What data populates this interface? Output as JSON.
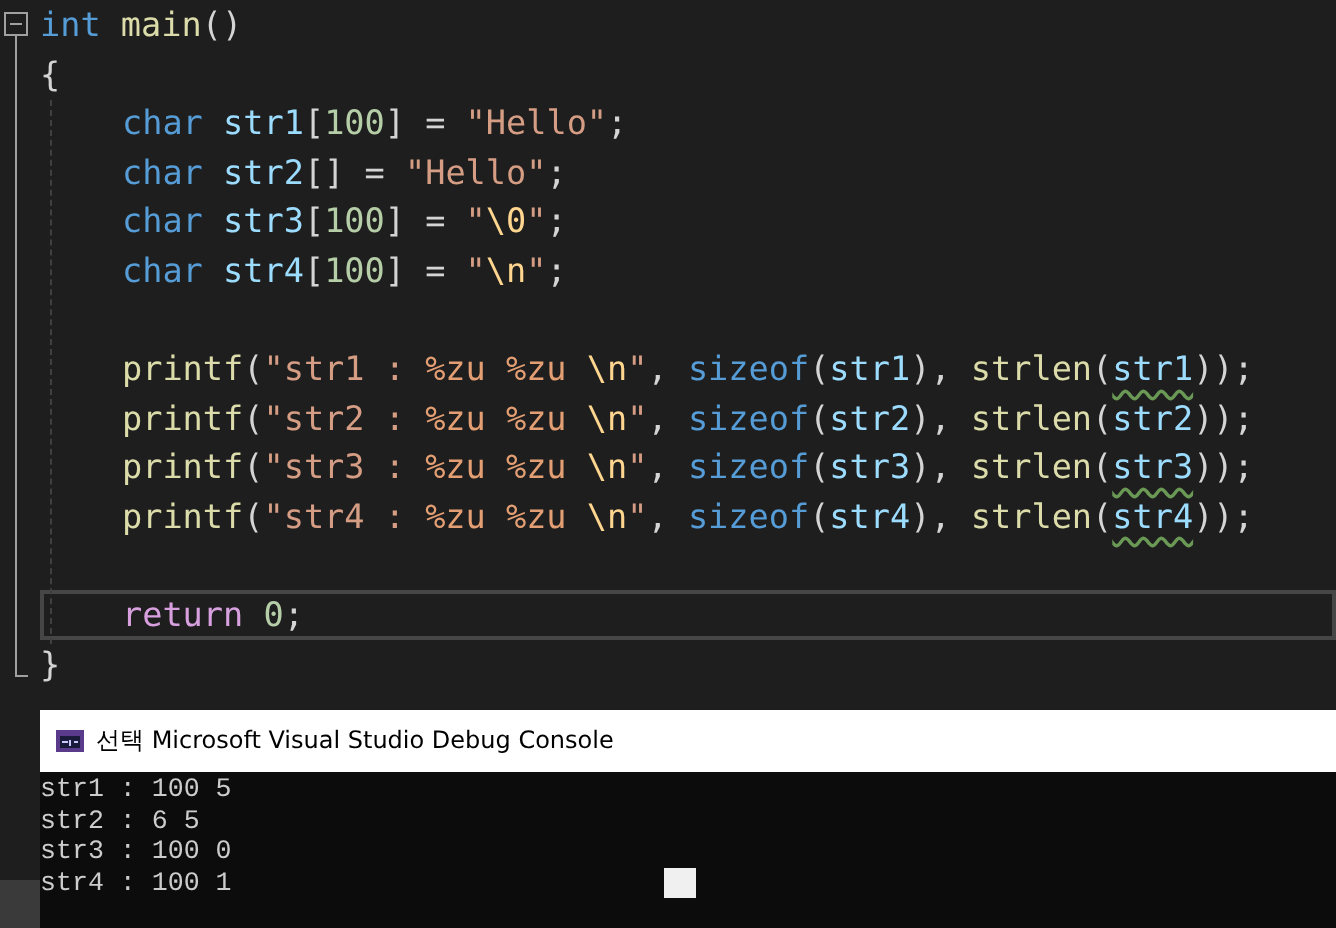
{
  "editor": {
    "lines": [
      {
        "current": false,
        "indented": false,
        "tokens": [
          {
            "text": "int",
            "kind": "keyword"
          },
          {
            "text": " main",
            "kind": "func"
          },
          {
            "text": "()",
            "kind": "punct"
          }
        ]
      },
      {
        "current": false,
        "indented": false,
        "tokens": [
          {
            "text": "{",
            "kind": "punct"
          }
        ]
      },
      {
        "current": false,
        "indented": true,
        "tokens": [
          {
            "text": "char",
            "kind": "keyword"
          },
          {
            "text": " str1",
            "kind": "var"
          },
          {
            "text": "[",
            "kind": "punct"
          },
          {
            "text": "100",
            "kind": "number"
          },
          {
            "text": "] = ",
            "kind": "punct"
          },
          {
            "text": "\"Hello\"",
            "kind": "string"
          },
          {
            "text": ";",
            "kind": "punct"
          }
        ]
      },
      {
        "current": false,
        "indented": true,
        "tokens": [
          {
            "text": "char",
            "kind": "keyword"
          },
          {
            "text": " str2",
            "kind": "var"
          },
          {
            "text": "[] = ",
            "kind": "punct"
          },
          {
            "text": "\"Hello\"",
            "kind": "string"
          },
          {
            "text": ";",
            "kind": "punct"
          }
        ]
      },
      {
        "current": false,
        "indented": true,
        "tokens": [
          {
            "text": "char",
            "kind": "keyword"
          },
          {
            "text": " str3",
            "kind": "var"
          },
          {
            "text": "[",
            "kind": "punct"
          },
          {
            "text": "100",
            "kind": "number"
          },
          {
            "text": "] = ",
            "kind": "punct"
          },
          {
            "text": "\"",
            "kind": "string"
          },
          {
            "text": "\\0",
            "kind": "escape"
          },
          {
            "text": "\"",
            "kind": "string"
          },
          {
            "text": ";",
            "kind": "punct"
          }
        ]
      },
      {
        "current": false,
        "indented": true,
        "blank_after": true,
        "tokens": [
          {
            "text": "char",
            "kind": "keyword"
          },
          {
            "text": " str4",
            "kind": "var"
          },
          {
            "text": "[",
            "kind": "punct"
          },
          {
            "text": "100",
            "kind": "number"
          },
          {
            "text": "] = ",
            "kind": "punct"
          },
          {
            "text": "\"",
            "kind": "string"
          },
          {
            "text": "\\n",
            "kind": "escape"
          },
          {
            "text": "\"",
            "kind": "string"
          },
          {
            "text": ";",
            "kind": "punct"
          }
        ]
      },
      {
        "current": false,
        "indented": true,
        "tokens": [
          {
            "text": "printf",
            "kind": "func"
          },
          {
            "text": "(",
            "kind": "punct"
          },
          {
            "text": "\"str1 : ",
            "kind": "string"
          },
          {
            "text": "%zu",
            "kind": "format"
          },
          {
            "text": " %zu",
            "kind": "format"
          },
          {
            "text": " \\n",
            "kind": "escape"
          },
          {
            "text": "\"",
            "kind": "string"
          },
          {
            "text": ", ",
            "kind": "punct"
          },
          {
            "text": "sizeof",
            "kind": "keyword"
          },
          {
            "text": "(",
            "kind": "punct"
          },
          {
            "text": "str1",
            "kind": "var"
          },
          {
            "text": "), ",
            "kind": "punct"
          },
          {
            "text": "strlen",
            "kind": "func"
          },
          {
            "text": "(",
            "kind": "punct"
          },
          {
            "text": "str1",
            "kind": "flagged-var"
          },
          {
            "text": "));",
            "kind": "punct"
          }
        ]
      },
      {
        "current": false,
        "indented": true,
        "tokens": [
          {
            "text": "printf",
            "kind": "func"
          },
          {
            "text": "(",
            "kind": "punct"
          },
          {
            "text": "\"str2 : ",
            "kind": "string"
          },
          {
            "text": "%zu",
            "kind": "format"
          },
          {
            "text": " %zu",
            "kind": "format"
          },
          {
            "text": " \\n",
            "kind": "escape"
          },
          {
            "text": "\"",
            "kind": "string"
          },
          {
            "text": ", ",
            "kind": "punct"
          },
          {
            "text": "sizeof",
            "kind": "keyword"
          },
          {
            "text": "(",
            "kind": "punct"
          },
          {
            "text": "str2",
            "kind": "var"
          },
          {
            "text": "), ",
            "kind": "punct"
          },
          {
            "text": "strlen",
            "kind": "func"
          },
          {
            "text": "(",
            "kind": "punct"
          },
          {
            "text": "str2",
            "kind": "var"
          },
          {
            "text": "));",
            "kind": "punct"
          }
        ]
      },
      {
        "current": false,
        "indented": true,
        "tokens": [
          {
            "text": "printf",
            "kind": "func"
          },
          {
            "text": "(",
            "kind": "punct"
          },
          {
            "text": "\"str3 : ",
            "kind": "string"
          },
          {
            "text": "%zu",
            "kind": "format"
          },
          {
            "text": " %zu",
            "kind": "format"
          },
          {
            "text": " \\n",
            "kind": "escape"
          },
          {
            "text": "\"",
            "kind": "string"
          },
          {
            "text": ", ",
            "kind": "punct"
          },
          {
            "text": "sizeof",
            "kind": "keyword"
          },
          {
            "text": "(",
            "kind": "punct"
          },
          {
            "text": "str3",
            "kind": "var"
          },
          {
            "text": "), ",
            "kind": "punct"
          },
          {
            "text": "strlen",
            "kind": "func"
          },
          {
            "text": "(",
            "kind": "punct"
          },
          {
            "text": "str3",
            "kind": "flagged-var"
          },
          {
            "text": "));",
            "kind": "punct"
          }
        ]
      },
      {
        "current": false,
        "indented": true,
        "blank_after": true,
        "tokens": [
          {
            "text": "printf",
            "kind": "func"
          },
          {
            "text": "(",
            "kind": "punct"
          },
          {
            "text": "\"str4 : ",
            "kind": "string"
          },
          {
            "text": "%zu",
            "kind": "format"
          },
          {
            "text": " %zu",
            "kind": "format"
          },
          {
            "text": " \\n",
            "kind": "escape"
          },
          {
            "text": "\"",
            "kind": "string"
          },
          {
            "text": ", ",
            "kind": "punct"
          },
          {
            "text": "sizeof",
            "kind": "keyword"
          },
          {
            "text": "(",
            "kind": "punct"
          },
          {
            "text": "str4",
            "kind": "var"
          },
          {
            "text": "), ",
            "kind": "punct"
          },
          {
            "text": "strlen",
            "kind": "func"
          },
          {
            "text": "(",
            "kind": "punct"
          },
          {
            "text": "str4",
            "kind": "flagged-var"
          },
          {
            "text": "));",
            "kind": "punct"
          }
        ]
      },
      {
        "current": true,
        "indented": true,
        "tokens": [
          {
            "text": "return",
            "kind": "control"
          },
          {
            "text": " 0",
            "kind": "number"
          },
          {
            "text": ";",
            "kind": "punct"
          }
        ]
      },
      {
        "current": false,
        "indented": false,
        "tokens": [
          {
            "text": "}",
            "kind": "punct"
          }
        ]
      }
    ]
  },
  "console": {
    "title": "선택 Microsoft Visual Studio Debug Console",
    "output": [
      "str1 : 100 5",
      "str2 : 6 5",
      "str3 : 100 0",
      "str4 : 100 1"
    ]
  }
}
